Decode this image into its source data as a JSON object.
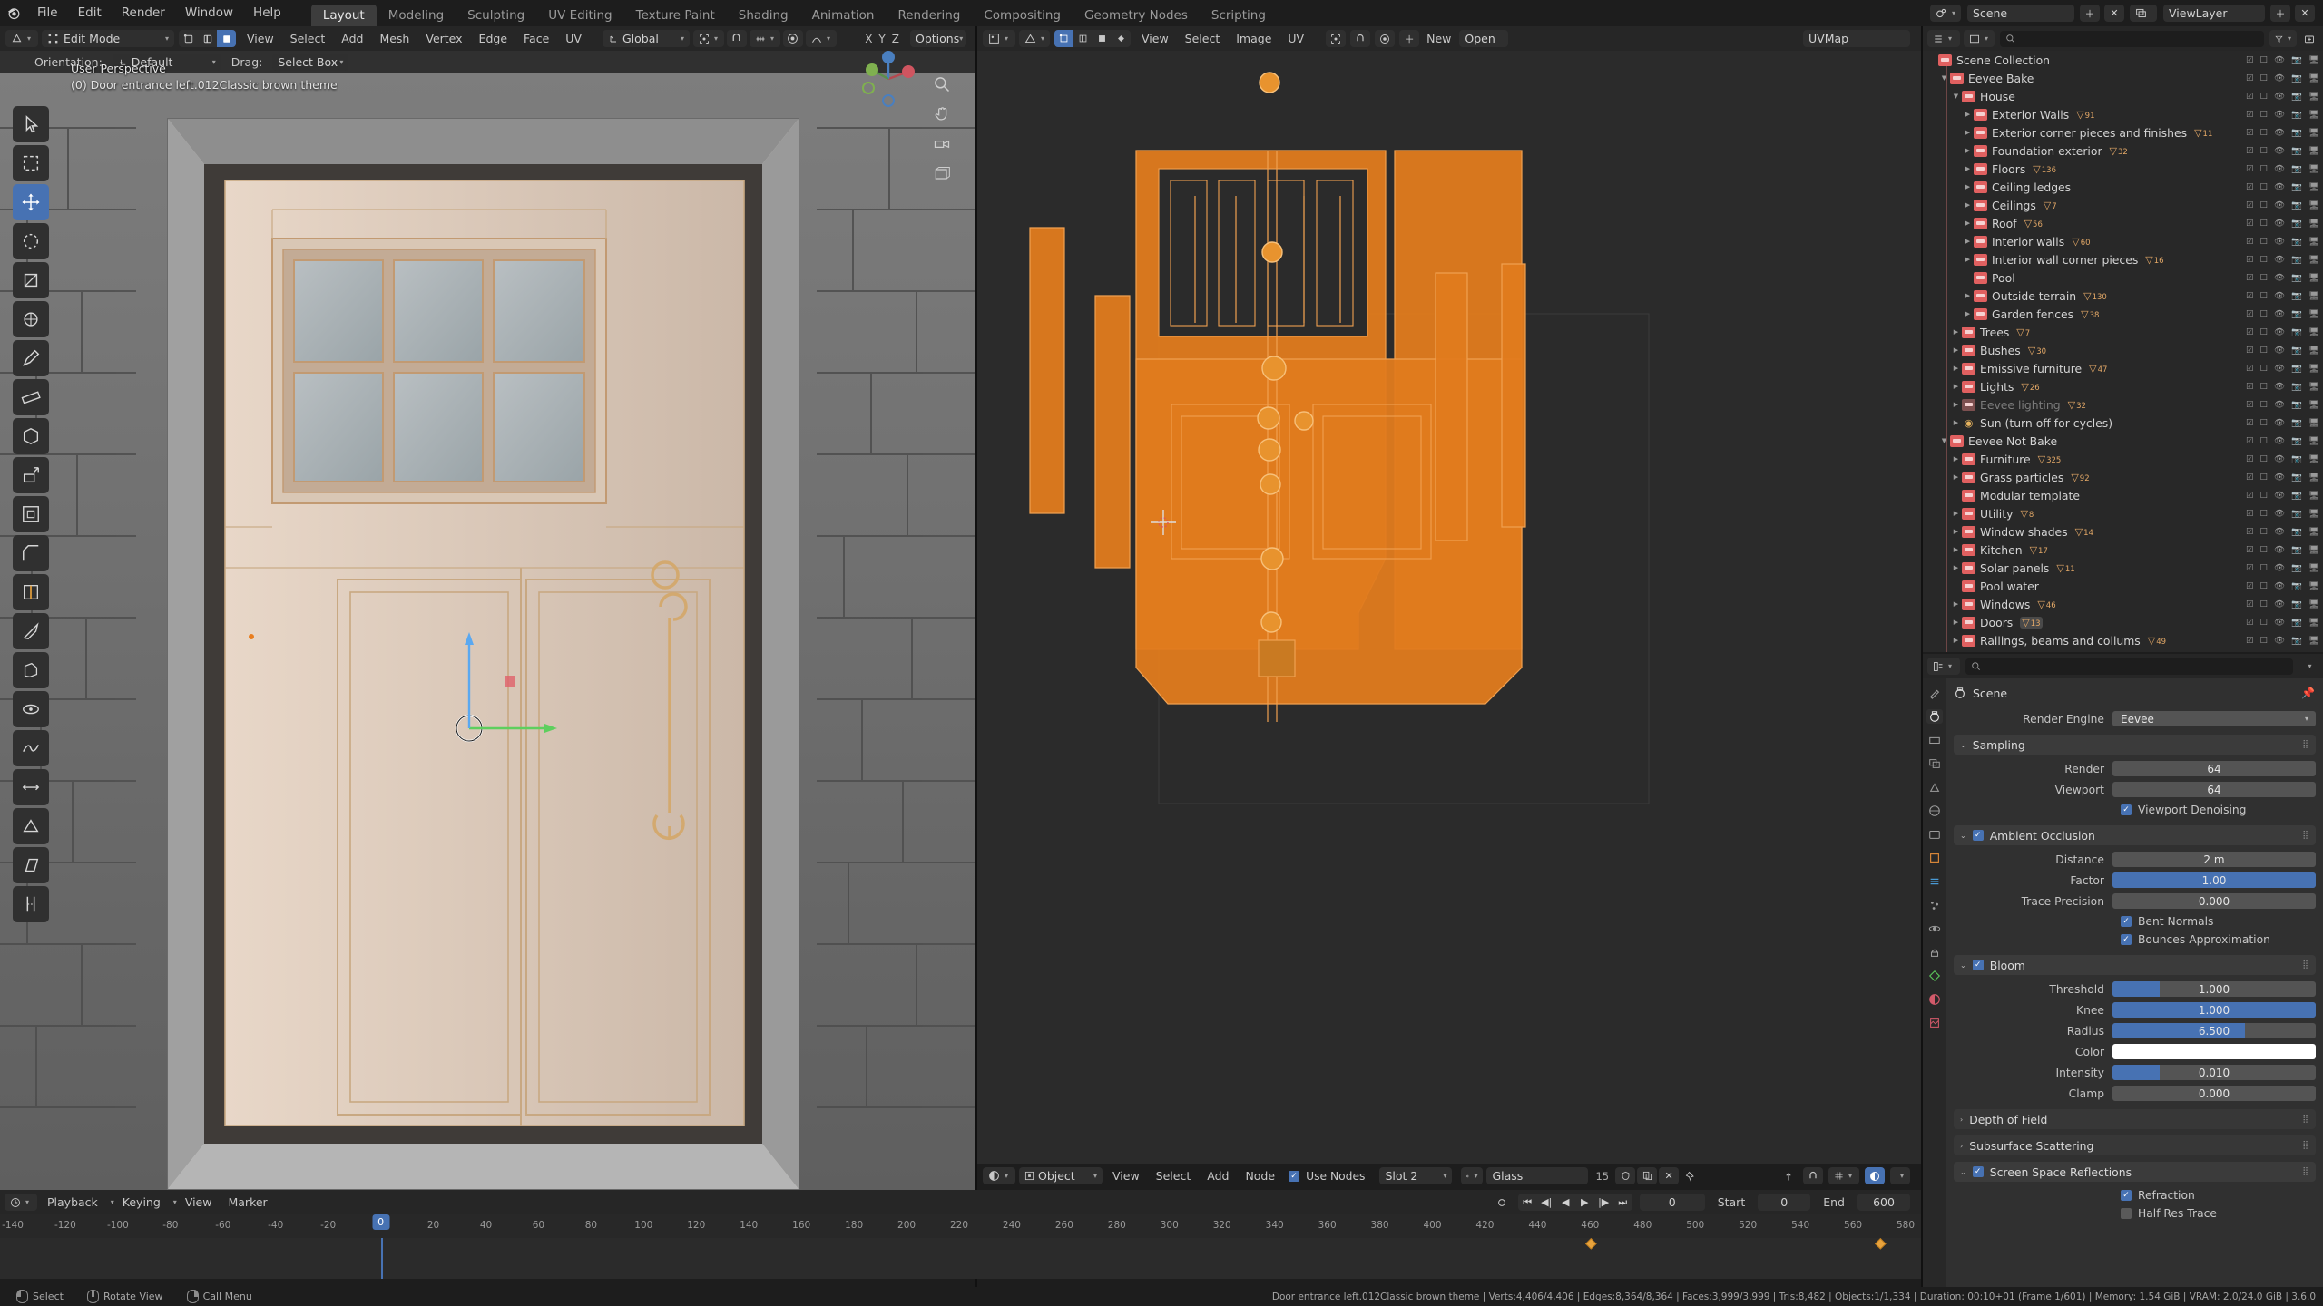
{
  "topbar": {
    "menus": [
      "File",
      "Edit",
      "Render",
      "Window",
      "Help"
    ],
    "workspaces": [
      "Layout",
      "Modeling",
      "Sculpting",
      "UV Editing",
      "Texture Paint",
      "Shading",
      "Animation",
      "Rendering",
      "Compositing",
      "Geometry Nodes",
      "Scripting"
    ],
    "active_workspace": "Layout",
    "scene_name": "Scene",
    "viewlayer_name": "ViewLayer"
  },
  "viewport": {
    "mode": "Edit Mode",
    "menus": [
      "View",
      "Select",
      "Add",
      "Mesh",
      "Vertex",
      "Edge",
      "Face",
      "UV"
    ],
    "transform_orientation": "Global",
    "tool_settings": {
      "orientation_label": "Orientation:",
      "orientation_value": "Default",
      "drag_label": "Drag:",
      "drag_value": "Select Box"
    },
    "options_label": "Options",
    "proportional_axis": [
      "X",
      "Y",
      "Z"
    ],
    "overlay_line1": "User Perspective",
    "overlay_line2": "(0) Door entrance left.012Classic brown theme"
  },
  "uv_editor": {
    "menus": [
      "View",
      "Select",
      "Image",
      "UV"
    ],
    "mode": "UV Editor",
    "image_label": "UVMap",
    "new_label": "New",
    "open_label": "Open"
  },
  "shader_footer": {
    "shader_type": "Object",
    "menus": [
      "View",
      "Select",
      "Add",
      "Node"
    ],
    "use_nodes_label": "Use Nodes",
    "use_nodes_checked": true,
    "slot": "Slot 2",
    "material": "Glass",
    "material_users": "15"
  },
  "outliner": {
    "display_mode": "View Layer",
    "filter_placeholder": "",
    "root": "Scene Collection",
    "rows": [
      {
        "label": "Scene Collection",
        "indent": 0,
        "disclosure": "",
        "icon": "collection",
        "count": ""
      },
      {
        "label": "Eevee Bake",
        "indent": 1,
        "disclosure": "down",
        "icon": "collection",
        "count": ""
      },
      {
        "label": "House",
        "indent": 2,
        "disclosure": "down",
        "icon": "collection",
        "count": ""
      },
      {
        "label": "Exterior Walls",
        "indent": 3,
        "disclosure": "right",
        "icon": "collection",
        "count": "91"
      },
      {
        "label": "Exterior corner pieces and finishes",
        "indent": 3,
        "disclosure": "right",
        "icon": "collection",
        "count": "11"
      },
      {
        "label": "Foundation exterior",
        "indent": 3,
        "disclosure": "right",
        "icon": "collection",
        "count": "32"
      },
      {
        "label": "Floors",
        "indent": 3,
        "disclosure": "right",
        "icon": "collection",
        "count": "136"
      },
      {
        "label": "Ceiling ledges",
        "indent": 3,
        "disclosure": "right",
        "icon": "collection",
        "count": ""
      },
      {
        "label": "Ceilings",
        "indent": 3,
        "disclosure": "right",
        "icon": "collection",
        "count": "7"
      },
      {
        "label": "Roof",
        "indent": 3,
        "disclosure": "right",
        "icon": "collection",
        "count": "56"
      },
      {
        "label": "Interior walls",
        "indent": 3,
        "disclosure": "right",
        "icon": "collection",
        "count": "60"
      },
      {
        "label": "Interior wall corner pieces",
        "indent": 3,
        "disclosure": "right",
        "icon": "collection",
        "count": "16"
      },
      {
        "label": "Pool",
        "indent": 3,
        "disclosure": "",
        "icon": "collection",
        "count": ""
      },
      {
        "label": "Outside terrain",
        "indent": 3,
        "disclosure": "right",
        "icon": "collection",
        "count": "130"
      },
      {
        "label": "Garden fences",
        "indent": 3,
        "disclosure": "right",
        "icon": "collection",
        "count": "38"
      },
      {
        "label": "Trees",
        "indent": 2,
        "disclosure": "right",
        "icon": "collection",
        "count": "7"
      },
      {
        "label": "Bushes",
        "indent": 2,
        "disclosure": "right",
        "icon": "collection",
        "count": "30"
      },
      {
        "label": "Emissive furniture",
        "indent": 2,
        "disclosure": "right",
        "icon": "collection",
        "count": "47"
      },
      {
        "label": "Lights",
        "indent": 2,
        "disclosure": "right",
        "icon": "collection",
        "count": "26"
      },
      {
        "label": "Eevee lighting",
        "indent": 2,
        "disclosure": "right",
        "icon": "collection",
        "count": "32",
        "dim": true
      },
      {
        "label": "Sun (turn off for cycles)",
        "indent": 2,
        "disclosure": "right",
        "icon": "light",
        "count": ""
      },
      {
        "label": "Eevee Not Bake",
        "indent": 1,
        "disclosure": "down",
        "icon": "collection",
        "count": ""
      },
      {
        "label": "Furniture",
        "indent": 2,
        "disclosure": "right",
        "icon": "collection",
        "count": "325"
      },
      {
        "label": "Grass particles",
        "indent": 2,
        "disclosure": "right",
        "icon": "collection",
        "count": "92"
      },
      {
        "label": "Modular template",
        "indent": 2,
        "disclosure": "",
        "icon": "collection",
        "count": ""
      },
      {
        "label": "Utility",
        "indent": 2,
        "disclosure": "right",
        "icon": "collection",
        "count": "8"
      },
      {
        "label": "Window shades",
        "indent": 2,
        "disclosure": "right",
        "icon": "collection",
        "count": "14"
      },
      {
        "label": "Kitchen",
        "indent": 2,
        "disclosure": "right",
        "icon": "collection",
        "count": "17"
      },
      {
        "label": "Solar panels",
        "indent": 2,
        "disclosure": "right",
        "icon": "collection",
        "count": "11"
      },
      {
        "label": "Pool water",
        "indent": 2,
        "disclosure": "",
        "icon": "collection",
        "count": ""
      },
      {
        "label": "Windows",
        "indent": 2,
        "disclosure": "right",
        "icon": "collection",
        "count": "46"
      },
      {
        "label": "Doors",
        "indent": 2,
        "disclosure": "right",
        "icon": "collection",
        "count": "13",
        "highlight": true
      },
      {
        "label": "Railings, beams and collums",
        "indent": 2,
        "disclosure": "right",
        "icon": "collection",
        "count": "49"
      }
    ]
  },
  "properties": {
    "breadcrumb": "Scene",
    "render_engine_label": "Render Engine",
    "render_engine_value": "Eevee",
    "panels": [
      {
        "name": "Sampling",
        "open": true,
        "checkbox": null,
        "rows": [
          {
            "label": "Render",
            "value": "64",
            "fill": 0
          },
          {
            "label": "Viewport",
            "value": "64",
            "fill": 0
          }
        ],
        "checkrows": [
          {
            "label": "Viewport Denoising",
            "checked": true
          }
        ]
      },
      {
        "name": "Ambient Occlusion",
        "open": true,
        "checkbox": true,
        "rows": [
          {
            "label": "Distance",
            "value": "2 m",
            "fill": 0
          },
          {
            "label": "Factor",
            "value": "1.00",
            "fill": 100
          },
          {
            "label": "Trace Precision",
            "value": "0.000",
            "fill": 0
          }
        ],
        "checkrows": [
          {
            "label": "Bent Normals",
            "checked": true
          },
          {
            "label": "Bounces Approximation",
            "checked": true
          }
        ]
      },
      {
        "name": "Bloom",
        "open": true,
        "checkbox": true,
        "rows": [
          {
            "label": "Threshold",
            "value": "1.000",
            "fill": 23
          },
          {
            "label": "Knee",
            "value": "1.000",
            "fill": 100
          },
          {
            "label": "Radius",
            "value": "6.500",
            "fill": 65
          },
          {
            "label": "Color",
            "value": "",
            "fill": 0,
            "color": "#ffffff"
          },
          {
            "label": "Intensity",
            "value": "0.010",
            "fill": 23
          },
          {
            "label": "Clamp",
            "value": "0.000",
            "fill": 0
          }
        ],
        "checkrows": []
      },
      {
        "name": "Depth of Field",
        "open": false,
        "checkbox": null,
        "rows": [],
        "checkrows": []
      },
      {
        "name": "Subsurface Scattering",
        "open": false,
        "checkbox": null,
        "rows": [],
        "checkrows": []
      },
      {
        "name": "Screen Space Reflections",
        "open": true,
        "checkbox": true,
        "rows": [],
        "checkrows": [
          {
            "label": "Refraction",
            "checked": true
          },
          {
            "label": "Half Res Trace",
            "checked": false
          }
        ]
      }
    ]
  },
  "timeline": {
    "menus": [
      "Playback",
      "Keying",
      "View",
      "Marker"
    ],
    "current_frame": "0",
    "start_label": "Start",
    "start_value": "0",
    "end_label": "End",
    "end_value": "600",
    "frame_field": "0",
    "ticks": [
      "-140",
      "-120",
      "-100",
      "-80",
      "-60",
      "-40",
      "-20",
      "0",
      "20",
      "40",
      "60",
      "80",
      "100",
      "120",
      "140",
      "160",
      "180",
      "200",
      "220",
      "240",
      "260",
      "280",
      "300",
      "320",
      "340",
      "360",
      "380",
      "400",
      "420",
      "440",
      "460",
      "480",
      "500",
      "520",
      "540",
      "560",
      "580"
    ],
    "keyframes": [
      460,
      570
    ]
  },
  "statusbar": {
    "items": [
      {
        "icon": "mouse-left",
        "label": "Select"
      },
      {
        "icon": "mouse-middle",
        "label": "Rotate View"
      },
      {
        "icon": "mouse-right",
        "label": "Call Menu"
      }
    ],
    "stats": "Door entrance left.012Classic brown theme  |  Verts:4,406/4,406  |  Edges:8,364/8,364  |  Faces:3,999/3,999  |  Tris:8,482  |  Objects:1/1,334  |  Duration: 00:10+01 (Frame 1/601)  |  Memory: 1.54 GiB  |  VRAM: 2.0/24.0 GiB  |  3.6.0"
  },
  "colors": {
    "accent": "#4772b3",
    "collection": "#e06060",
    "mesh": "#e3a867",
    "selected_mesh": "#e87d1e"
  }
}
